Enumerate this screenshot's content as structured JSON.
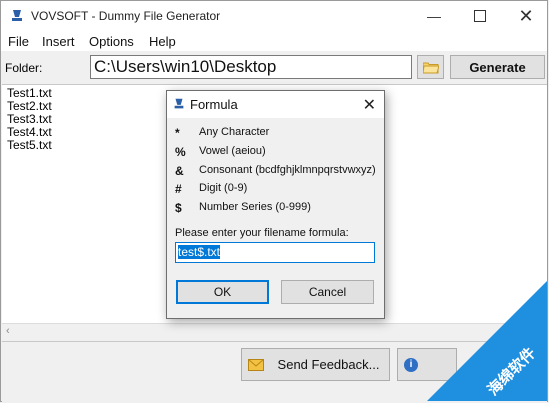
{
  "window": {
    "title": "VOVSOFT - Dummy File Generator"
  },
  "menu": [
    "File",
    "Insert",
    "Options",
    "Help"
  ],
  "toolbar": {
    "folder_label": "Folder:",
    "folder_value": "C:\\Users\\win10\\Desktop",
    "generate_label": "Generate"
  },
  "files": [
    "Test1.txt",
    "Test2.txt",
    "Test3.txt",
    "Test4.txt",
    "Test5.txt"
  ],
  "footer": {
    "feedback_label": "Send Feedback..."
  },
  "dialog": {
    "title": "Formula",
    "legend": [
      {
        "symbol": "*",
        "description": "Any Character"
      },
      {
        "symbol": "%",
        "description": "Vowel (aeiou)"
      },
      {
        "symbol": "&",
        "description": "Consonant (bcdfghjklmnpqrstvwxyz)"
      },
      {
        "symbol": "#",
        "description": "Digit (0-9)"
      },
      {
        "symbol": "$",
        "description": "Number Series (0-999)"
      }
    ],
    "prompt": "Please enter your filename formula:",
    "formula_value": "test$.txt",
    "ok_label": "OK",
    "cancel_label": "Cancel"
  },
  "watermark": {
    "text": "海绵软件"
  },
  "colors": {
    "accent": "#0078d7",
    "watermark": "#1f8fe0"
  }
}
